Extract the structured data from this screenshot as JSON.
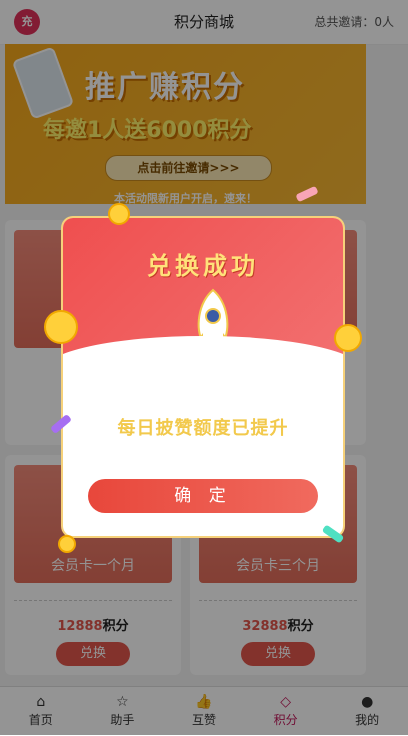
{
  "header": {
    "logo_text": "充",
    "title": "积分商城",
    "invite_text": "总共邀请：0人"
  },
  "banner": {
    "headline": "推广赚积分",
    "subline": "每邀1人送6000积分",
    "cta": "点击前往邀请>>>",
    "note": "本活动限新用户开启，速来！"
  },
  "products": [
    {
      "name": "",
      "price": "",
      "unit": "",
      "button": ""
    },
    {
      "name": "",
      "price": "",
      "unit": "",
      "button": ""
    },
    {
      "name": "会员卡一个月",
      "price": "12888",
      "unit": "积分",
      "button": "兑换"
    },
    {
      "name": "会员卡三个月",
      "price": "32888",
      "unit": "积分",
      "button": "兑换"
    }
  ],
  "tabs": [
    {
      "label": "首页",
      "icon": "home-icon"
    },
    {
      "label": "助手",
      "icon": "star-icon"
    },
    {
      "label": "互赞",
      "icon": "thumbs-up-icon"
    },
    {
      "label": "积分",
      "icon": "diamond-icon"
    },
    {
      "label": "我的",
      "icon": "user-icon"
    }
  ],
  "modal": {
    "title": "兑换成功",
    "message": "每日披赞额度已提升",
    "confirm": "确 定"
  },
  "colors": {
    "accent": "#e2574c",
    "brand": "#e0315b",
    "banner": "#f6a91c",
    "modal_top": "#ef4f4f",
    "gold": "#ffe27a"
  }
}
